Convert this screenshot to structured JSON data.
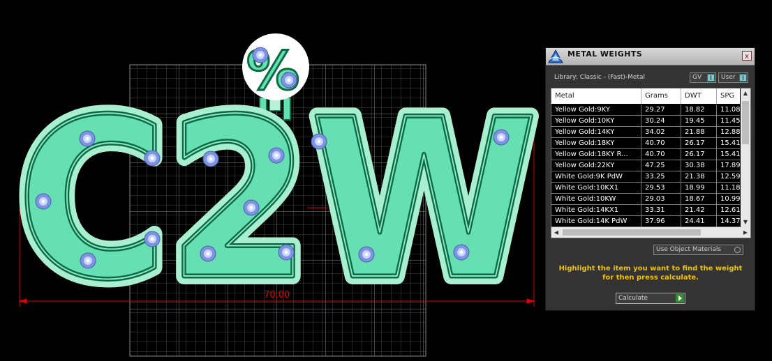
{
  "viewport": {
    "dimension_label": "70.00",
    "pendant_text": "C2W",
    "bail_symbol": "%",
    "colors": {
      "fill": "#66dfb2",
      "outline": "#0b6b46",
      "grid": "#6a6a6a",
      "dimension": "#e00000",
      "stone": "#8ea0e6"
    }
  },
  "panel": {
    "title": "METAL WEIGHTS",
    "close_label": "x",
    "library_label": "Library: Classic - (Fast)-Metal",
    "gv_label": "GV",
    "user_label": "User",
    "table": {
      "headers": [
        "Metal",
        "Grams",
        "DWT",
        "SPG"
      ],
      "rows": [
        [
          "Yellow Gold:9KY",
          "29.27",
          "18.82",
          "11.08"
        ],
        [
          "Yellow Gold:10KY",
          "30.24",
          "19.45",
          "11.45"
        ],
        [
          "Yellow Gold:14KY",
          "34.02",
          "21.88",
          "12.88"
        ],
        [
          "Yellow Gold:18KY",
          "40.70",
          "26.17",
          "15.41"
        ],
        [
          "Yellow Gold:18KY R...",
          "40.70",
          "26.17",
          "15.41"
        ],
        [
          "Yellow Gold:22KY",
          "47.25",
          "30.38",
          "17.89"
        ],
        [
          "White Gold:9K PdW",
          "33.25",
          "21.38",
          "12.59"
        ],
        [
          "White Gold:10KX1",
          "29.53",
          "18.99",
          "11.18"
        ],
        [
          "White Gold:10KW",
          "29.03",
          "18.67",
          "10.99"
        ],
        [
          "White Gold:14KX1",
          "33.31",
          "21.42",
          "12.61"
        ],
        [
          "White Gold:14K PdW",
          "37.96",
          "24.41",
          "14.37"
        ]
      ]
    },
    "use_object_materials_label": "Use Object Materials",
    "instructions": "Highlight the item you want to find the weight for then press calculate.",
    "calculate_label": "Calculate",
    "colors": {
      "instruction_text": "#f2c200",
      "panel_bg": "#333333"
    }
  }
}
